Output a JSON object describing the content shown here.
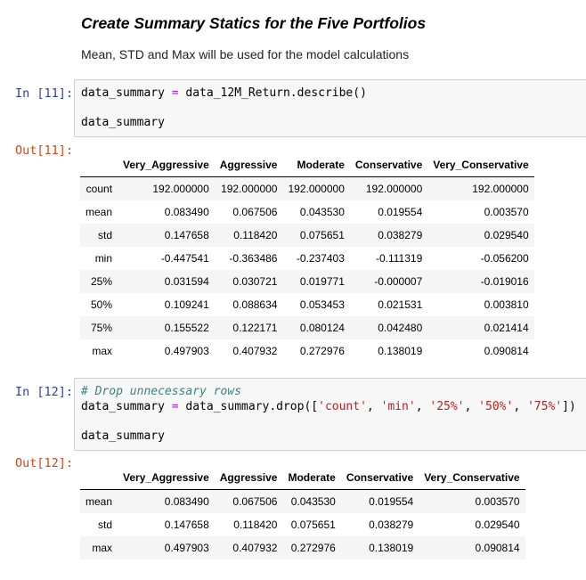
{
  "markdown": {
    "heading": "Create Summary Statics for the Five Portfolios",
    "text": "Mean, STD and Max will be used for the model calculations"
  },
  "cell11": {
    "in_prompt": "In [11]:",
    "out_prompt": "Out[11]:",
    "code": {
      "line1_var": "data_summary ",
      "line1_eq": "=",
      "line1_rest": " data_12M_Return.describe()",
      "line2": "data_summary"
    },
    "table": {
      "columns": [
        "Very_Aggressive",
        "Aggressive",
        "Moderate",
        "Conservative",
        "Very_Conservative"
      ],
      "rows": [
        {
          "index": "count",
          "values": [
            "192.000000",
            "192.000000",
            "192.000000",
            "192.000000",
            "192.000000"
          ]
        },
        {
          "index": "mean",
          "values": [
            "0.083490",
            "0.067506",
            "0.043530",
            "0.019554",
            "0.003570"
          ]
        },
        {
          "index": "std",
          "values": [
            "0.147658",
            "0.118420",
            "0.075651",
            "0.038279",
            "0.029540"
          ]
        },
        {
          "index": "min",
          "values": [
            "-0.447541",
            "-0.363486",
            "-0.237403",
            "-0.111319",
            "-0.056200"
          ]
        },
        {
          "index": "25%",
          "values": [
            "0.031594",
            "0.030721",
            "0.019771",
            "-0.000007",
            "-0.019016"
          ]
        },
        {
          "index": "50%",
          "values": [
            "0.109241",
            "0.088634",
            "0.053453",
            "0.021531",
            "0.003810"
          ]
        },
        {
          "index": "75%",
          "values": [
            "0.155522",
            "0.122171",
            "0.080124",
            "0.042480",
            "0.021414"
          ]
        },
        {
          "index": "max",
          "values": [
            "0.497903",
            "0.407932",
            "0.272976",
            "0.138019",
            "0.090814"
          ]
        }
      ]
    }
  },
  "cell12": {
    "in_prompt": "In [12]:",
    "out_prompt": "Out[12]:",
    "code": {
      "comment": "# Drop unnecessary rows",
      "l2_a": "data_summary ",
      "l2_eq": "=",
      "l2_b": " data_summary.drop([",
      "s1": "'count'",
      "s2": "'min'",
      "s3": "'25%'",
      "s4": "'50%'",
      "s5": "'75%'",
      "sep": ", ",
      "close": "])",
      "line3": "data_summary"
    },
    "table": {
      "columns": [
        "Very_Aggressive",
        "Aggressive",
        "Moderate",
        "Conservative",
        "Very_Conservative"
      ],
      "rows": [
        {
          "index": "mean",
          "values": [
            "0.083490",
            "0.067506",
            "0.043530",
            "0.019554",
            "0.003570"
          ]
        },
        {
          "index": "std",
          "values": [
            "0.147658",
            "0.118420",
            "0.075651",
            "0.038279",
            "0.029540"
          ]
        },
        {
          "index": "max",
          "values": [
            "0.497903",
            "0.407932",
            "0.272976",
            "0.138019",
            "0.090814"
          ]
        }
      ]
    }
  }
}
